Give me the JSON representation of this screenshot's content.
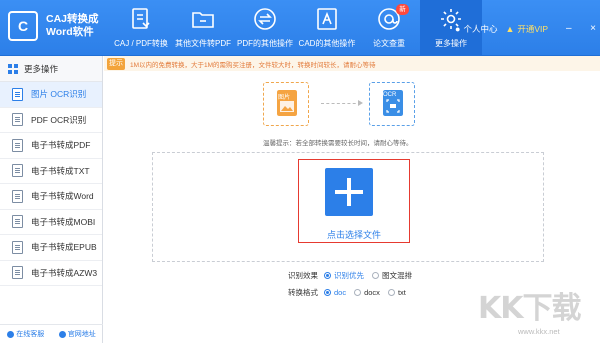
{
  "app": {
    "logo_mark": "C",
    "name_line1": "CAJ转换成",
    "name_line2": "Word软件"
  },
  "nav": [
    {
      "label": "CAJ / PDF转换",
      "icon": "convert-icon"
    },
    {
      "label": "其他文件转PDF",
      "icon": "folder-icon"
    },
    {
      "label": "PDF的其他操作",
      "icon": "swap-icon"
    },
    {
      "label": "CAD的其他操作",
      "icon": "cad-icon"
    },
    {
      "label": "论文查重",
      "icon": "search-at-icon",
      "badge": "新"
    },
    {
      "label": "更多操作",
      "icon": "gear-icon",
      "active": true
    }
  ],
  "top_right": {
    "user_label": "个人中心",
    "vip_label": "开通VIP"
  },
  "sidebar": {
    "header": "更多操作",
    "items": [
      {
        "label": "图片 OCR识别",
        "active": true
      },
      {
        "label": "PDF OCR识别"
      },
      {
        "label": "电子书转成PDF"
      },
      {
        "label": "电子书转成TXT"
      },
      {
        "label": "电子书转成Word"
      },
      {
        "label": "电子书转成MOBI"
      },
      {
        "label": "电子书转成EPUB"
      },
      {
        "label": "电子书转成AZW3"
      }
    ],
    "footer": {
      "service": "在线客服",
      "website": "官网地址"
    }
  },
  "notice": {
    "badge": "提示",
    "text": "1M以内的免费转换，大于1M的需购买注册，文件较大时，转换时间较长，请耐心等待"
  },
  "flow": {
    "source_label": "图片",
    "target_label": "OCR"
  },
  "tip": "温馨提示：若全部转换需要较长时间，请耐心等待。",
  "select_file": "点击选择文件",
  "options": {
    "effect": {
      "title": "识别效果",
      "choices": [
        "识别优先",
        "图文混排"
      ],
      "selected": 0
    },
    "format": {
      "title": "转换格式",
      "choices": [
        "doc",
        "docx",
        "txt"
      ],
      "selected": 0
    }
  },
  "watermark": {
    "brand": "KK下载",
    "url": "www.kkx.net"
  },
  "colors": {
    "primary": "#2c7fe8",
    "highlight": "#e63a30",
    "notice": "#e27a3a"
  }
}
